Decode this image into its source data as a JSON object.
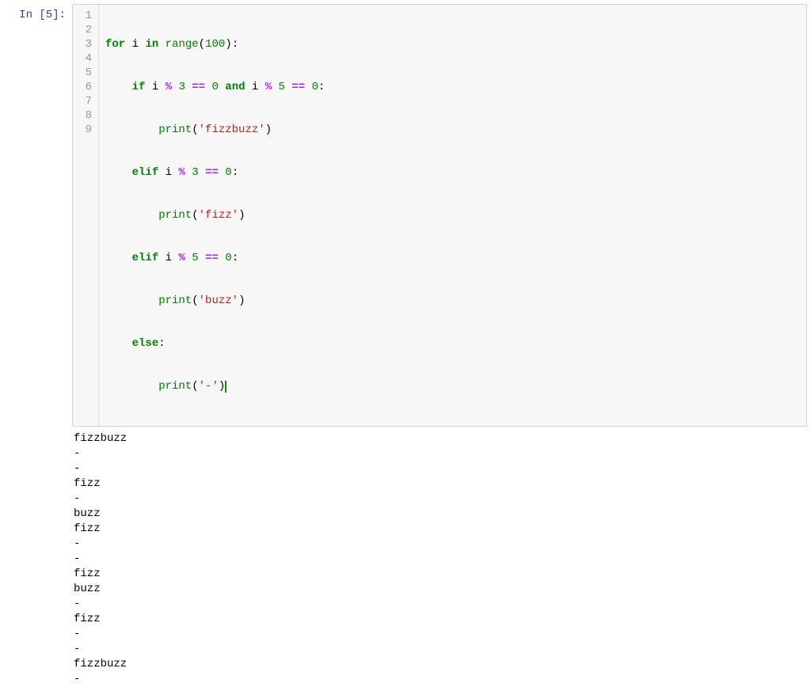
{
  "cell": {
    "prompt_prefix": "In [",
    "exec_count": "5",
    "prompt_suffix": "]:",
    "gutter": [
      "1",
      "2",
      "3",
      "4",
      "5",
      "6",
      "7",
      "8",
      "9"
    ],
    "code": {
      "l1": {
        "for": "for",
        "i": "i",
        "in": "in",
        "range": "range",
        "open": "(",
        "n": "100",
        "close": ")",
        "colon": ":"
      },
      "l2": {
        "if": "if",
        "i1": "i",
        "mod1": "%",
        "three": "3",
        "eq1": "==",
        "zero1": "0",
        "and": "and",
        "i2": "i",
        "mod2": "%",
        "five": "5",
        "eq2": "==",
        "zero2": "0",
        "colon": ":"
      },
      "l3": {
        "print": "print",
        "open": "(",
        "q1": "'",
        "s": "fizzbuzz",
        "q2": "'",
        "close": ")"
      },
      "l4": {
        "elif": "elif",
        "i": "i",
        "mod": "%",
        "three": "3",
        "eq": "==",
        "zero": "0",
        "colon": ":"
      },
      "l5": {
        "print": "print",
        "open": "(",
        "q1": "'",
        "s": "fizz",
        "q2": "'",
        "close": ")"
      },
      "l6": {
        "elif": "elif",
        "i": "i",
        "mod": "%",
        "five": "5",
        "eq": "==",
        "zero": "0",
        "colon": ":"
      },
      "l7": {
        "print": "print",
        "open": "(",
        "q1": "'",
        "s": "buzz",
        "q2": "'",
        "close": ")"
      },
      "l8": {
        "else": "else",
        "colon": ":"
      },
      "l9": {
        "print": "print",
        "open": "(",
        "q1": "'",
        "s": "-",
        "q2": "'",
        "close": ")"
      }
    }
  },
  "output_lines": [
    "fizzbuzz",
    "-",
    "-",
    "fizz",
    "-",
    "buzz",
    "fizz",
    "-",
    "-",
    "fizz",
    "buzz",
    "-",
    "fizz",
    "-",
    "-",
    "fizzbuzz",
    "-"
  ]
}
